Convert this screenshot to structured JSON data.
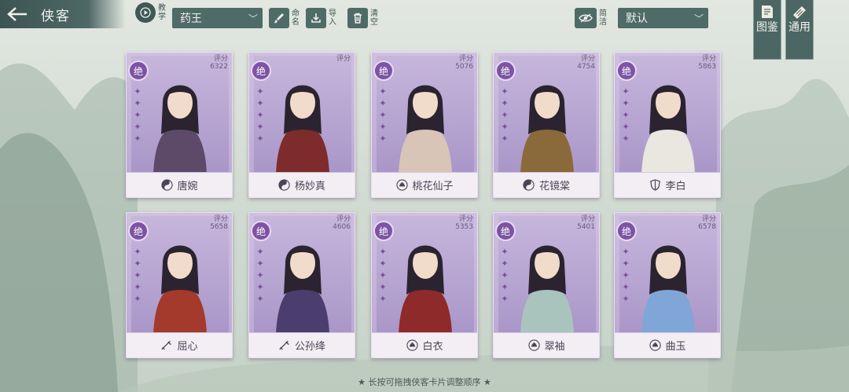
{
  "header": {
    "title": "侠客",
    "tutorial_label": "教学",
    "filter_value": "药王",
    "rename_label": "命名",
    "import_label": "导入",
    "clear_label": "清空",
    "simple_label": "简洁",
    "sort_value": "默认",
    "codex_label": "图鉴",
    "common_label": "通用"
  },
  "rank_label": "绝",
  "score_label": "评分",
  "cards": [
    {
      "name": "唐婉",
      "score": "6322",
      "class_icon": "taiji-icon",
      "color": "#5c4a68"
    },
    {
      "name": "杨妙真",
      "score": "",
      "class_icon": "taiji-icon",
      "color": "#7e2b2b"
    },
    {
      "name": "桃花仙子",
      "score": "5076",
      "class_icon": "lotus-icon",
      "color": "#d9c4b8"
    },
    {
      "name": "花镜棠",
      "score": "4754",
      "class_icon": "taiji-icon",
      "color": "#8a6a3a"
    },
    {
      "name": "李白",
      "score": "5863",
      "class_icon": "shield-icon",
      "color": "#eae6e0"
    },
    {
      "name": "屈心",
      "score": "5658",
      "class_icon": "sword-icon",
      "color": "#a33a2c"
    },
    {
      "name": "公孙绛",
      "score": "4606",
      "class_icon": "sword-icon",
      "color": "#4b3d6e"
    },
    {
      "name": "白衣",
      "score": "5353",
      "class_icon": "lotus-icon",
      "color": "#8e2a2a"
    },
    {
      "name": "翠袖",
      "score": "5401",
      "class_icon": "lotus-icon",
      "color": "#a9c4bc"
    },
    {
      "name": "曲玉",
      "score": "6578",
      "class_icon": "lotus-icon",
      "color": "#7fa6d6"
    }
  ],
  "hint": "★ 长按可拖拽侠客卡片调整顺序 ★"
}
